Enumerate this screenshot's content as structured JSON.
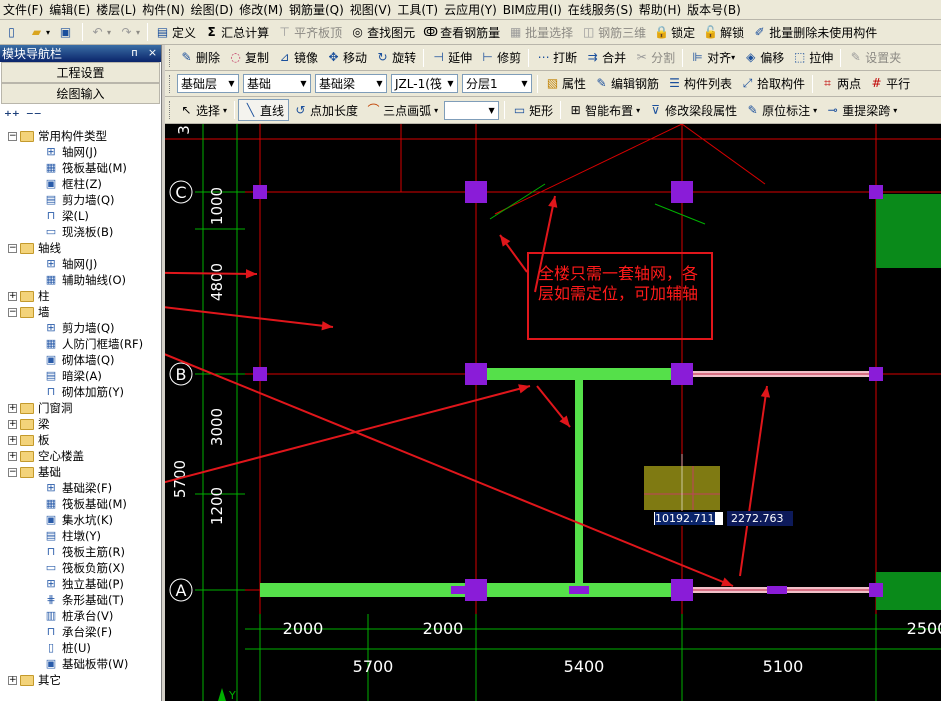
{
  "menubar": {
    "items": [
      "文件(F)",
      "编辑(E)",
      "楼层(L)",
      "构件(N)",
      "绘图(D)",
      "修改(M)",
      "钢筋量(Q)",
      "视图(V)",
      "工具(T)",
      "云应用(Y)",
      "BIM应用(I)",
      "在线服务(S)",
      "帮助(H)",
      "版本号(B)"
    ]
  },
  "toolbar1": {
    "define": "定义",
    "sum_calc": "汇总计算",
    "align_top": "平齐板顶",
    "find_element": "查找图元",
    "view_rebar": "查看钢筋量",
    "batch_select": "批量选择",
    "rebar_3d": "钢筋三维",
    "lock": "锁定",
    "unlock": "解锁",
    "batch_delete_unused": "批量删除未使用构件"
  },
  "toolbar2": {
    "delete": "删除",
    "copy": "复制",
    "mirror": "镜像",
    "move": "移动",
    "rotate": "旋转",
    "extend": "延伸",
    "trim": "修剪",
    "break": "打断",
    "merge": "合并",
    "split": "分割",
    "align": "对齐",
    "offset": "偏移",
    "stretch": "拉伸",
    "set_clamp": "设置夹"
  },
  "toolbar3": {
    "floor": "基础层",
    "category": "基础",
    "element_type": "基础梁",
    "element_name": "JZL-1(筏",
    "sublayer": "分层1",
    "properties": "属性",
    "edit_rebar": "编辑钢筋",
    "element_list": "构件列表",
    "pick_element": "拾取构件",
    "two_points": "两点",
    "parallel": "平行"
  },
  "toolbar4": {
    "select": "选择",
    "line": "直线",
    "point_length": "点加长度",
    "three_point_arc": "三点画弧",
    "rectangle": "矩形",
    "smart_layout": "智能布置",
    "modify_beam_props": "修改梁段属性",
    "origin_annotation": "原位标注",
    "reextract_span": "重提梁跨"
  },
  "nav": {
    "title": "模块导航栏",
    "pin": "ᴨ",
    "close": "×",
    "project_settings": "工程设置",
    "drawing_input": "绘图输入",
    "groups": [
      {
        "label": "常用构件类型",
        "expanded": true,
        "children": [
          "轴网(J)",
          "筏板基础(M)",
          "框柱(Z)",
          "剪力墙(Q)",
          "梁(L)",
          "现浇板(B)"
        ]
      },
      {
        "label": "轴线",
        "expanded": true,
        "children": [
          "轴网(J)",
          "辅助轴线(O)"
        ]
      },
      {
        "label": "柱",
        "expanded": false,
        "children": []
      },
      {
        "label": "墙",
        "expanded": true,
        "children": [
          "剪力墙(Q)",
          "人防门框墙(RF)",
          "砌体墙(Q)",
          "暗梁(A)",
          "砌体加筋(Y)"
        ]
      },
      {
        "label": "门窗洞",
        "expanded": false,
        "children": []
      },
      {
        "label": "梁",
        "expanded": false,
        "children": []
      },
      {
        "label": "板",
        "expanded": false,
        "children": []
      },
      {
        "label": "空心楼盖",
        "expanded": false,
        "children": []
      },
      {
        "label": "基础",
        "expanded": true,
        "children": [
          "基础梁(F)",
          "筏板基础(M)",
          "集水坑(K)",
          "柱墩(Y)",
          "筏板主筋(R)",
          "筏板负筋(X)",
          "独立基础(P)",
          "条形基础(T)",
          "桩承台(V)",
          "承台梁(F)",
          "桩(U)",
          "基础板带(W)"
        ]
      },
      {
        "label": "其它",
        "expanded": false,
        "children": []
      }
    ]
  },
  "canvas": {
    "axis_labels": [
      "C",
      "B",
      "A"
    ],
    "left_dims": [
      "1000",
      "4800",
      "3000",
      "5700",
      "1200"
    ],
    "top_partial_dim": "3",
    "bottom_dims_top_row": [
      "2000",
      "2000",
      "2500"
    ],
    "bottom_dims_main": [
      "5700",
      "5400",
      "5100"
    ],
    "callout_text": "全楼只需一套轴网，各层如需定位，可加辅轴",
    "coord_x": "10192.711",
    "coord_y": "2272.763",
    "ucs_label": "Y",
    "colors": {
      "grid_red": "#d60000",
      "beam_green": "#55e04a",
      "dim_green": "#00b000",
      "node_purple": "#8a1cd8",
      "annotation_red": "#e0161b",
      "dim_text": "#ffffff"
    }
  }
}
